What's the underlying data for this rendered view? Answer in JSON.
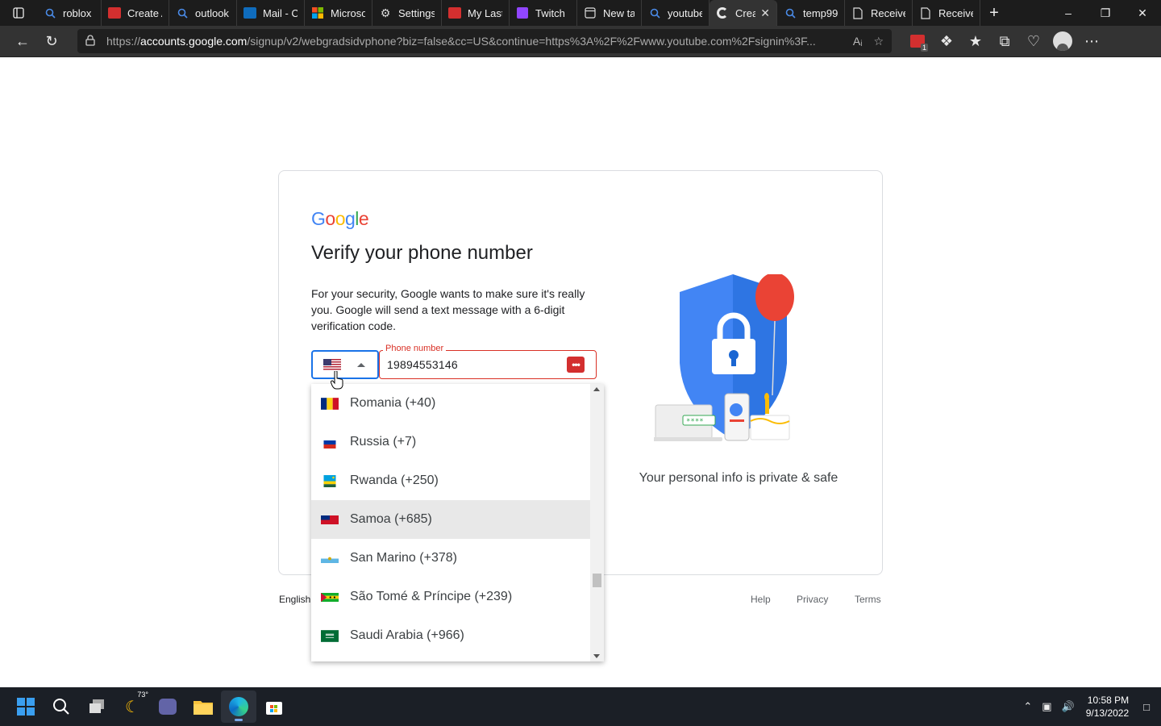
{
  "browser": {
    "tabs": [
      {
        "label": "roblox -",
        "icon": "search-icon"
      },
      {
        "label": "Create A",
        "icon": "lastpass-icon"
      },
      {
        "label": "outlook -",
        "icon": "search-icon"
      },
      {
        "label": "Mail - Co",
        "icon": "outlook-icon"
      },
      {
        "label": "Microsof",
        "icon": "microsoft-icon"
      },
      {
        "label": "Settings",
        "icon": "gear-icon"
      },
      {
        "label": "My LastP",
        "icon": "lastpass-icon"
      },
      {
        "label": "Twitch",
        "icon": "twitch-icon"
      },
      {
        "label": "New tab",
        "icon": "newtab-icon"
      },
      {
        "label": "youtube",
        "icon": "search-icon"
      },
      {
        "label": "Crea",
        "icon": "google-icon",
        "active": true
      },
      {
        "label": "temp99",
        "icon": "search-icon"
      },
      {
        "label": "Receive",
        "icon": "page-icon"
      },
      {
        "label": "Receive",
        "icon": "page-icon"
      }
    ],
    "url_prefix": "https://",
    "url_domain": "accounts.google.com",
    "url_path": "/signup/v2/webgradsidvphone?biz=false&cc=US&continue=https%3A%2F%2Fwww.youtube.com%2Fsignin%3F...",
    "lastpass_badge": "1"
  },
  "page": {
    "logo": "Google",
    "title": "Verify your phone number",
    "description": "For your security, Google wants to make sure it's really you. Google will send a text message with a 6-digit verification code.",
    "phone_label": "Phone number",
    "phone_value": "19894553146",
    "lastpass_dots": "•••",
    "caption": "Your personal info is private & safe",
    "footer_language": "English",
    "footer_links": [
      "Help",
      "Privacy",
      "Terms"
    ]
  },
  "dropdown": {
    "options": [
      {
        "label": "Romania (+40)",
        "flag": "romania"
      },
      {
        "label": "Russia (+7)",
        "flag": "russia"
      },
      {
        "label": "Rwanda (+250)",
        "flag": "rwanda"
      },
      {
        "label": "Samoa (+685)",
        "flag": "samoa",
        "highlighted": true
      },
      {
        "label": "San Marino (+378)",
        "flag": "san-marino"
      },
      {
        "label": "São Tomé & Príncipe (+239)",
        "flag": "sao-tome"
      },
      {
        "label": "Saudi Arabia (+966)",
        "flag": "saudi-arabia"
      }
    ]
  },
  "taskbar": {
    "weather": "73°",
    "time": "10:58 PM",
    "date": "9/13/2022"
  },
  "colors": {
    "google_blue": "#4285F4",
    "google_red": "#EA4335",
    "google_yellow": "#FBBC05",
    "google_green": "#34A853",
    "focus_blue": "#1a73e8",
    "error_red": "#d93025"
  }
}
